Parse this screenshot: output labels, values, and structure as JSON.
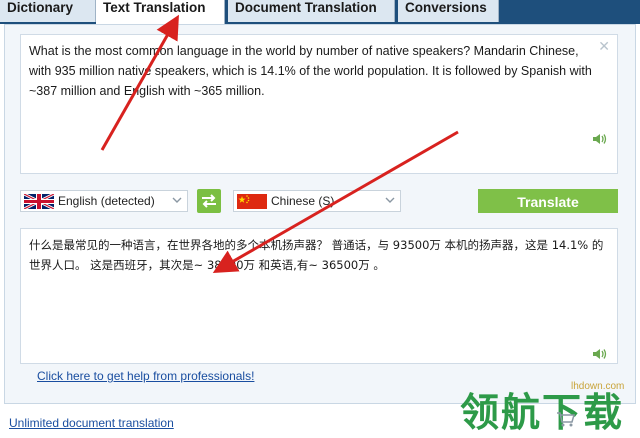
{
  "tabs": [
    {
      "label": "Dictionary"
    },
    {
      "label": "Text Translation"
    },
    {
      "label": "Document Translation"
    },
    {
      "label": "Conversions"
    }
  ],
  "source": {
    "text": "What is the most common language in the world by number of native speakers? Mandarin Chinese, with 935 million native speakers, which is 14.1% of the world population. It is followed by Spanish with ~387 million and English with ~365 million."
  },
  "source_language": {
    "selected": "English (detected)"
  },
  "target_language": {
    "selected": "Chinese (S)"
  },
  "translate_button": {
    "label": "Translate"
  },
  "result": {
    "text": "什么是最常见的一种语言，在世界各地的多个本机扬声器？ 普通话，与 93500万 本机的扬声器，这是 14.1% 的世界人口。 这是西班牙，其次是~ 38700万 和英语,有~ 36500万 。"
  },
  "help_link": {
    "label": "Click here to get help from professionals!"
  },
  "footer_link": {
    "label": "Unlimited document translation"
  },
  "watermark": {
    "site": "lhdown.com",
    "brand": "领航下载"
  },
  "colors": {
    "tab_bar": "#1e4f7c",
    "accent_green": "#7fc048",
    "arrow_red": "#d8221f",
    "link_blue": "#1a4ea0"
  }
}
